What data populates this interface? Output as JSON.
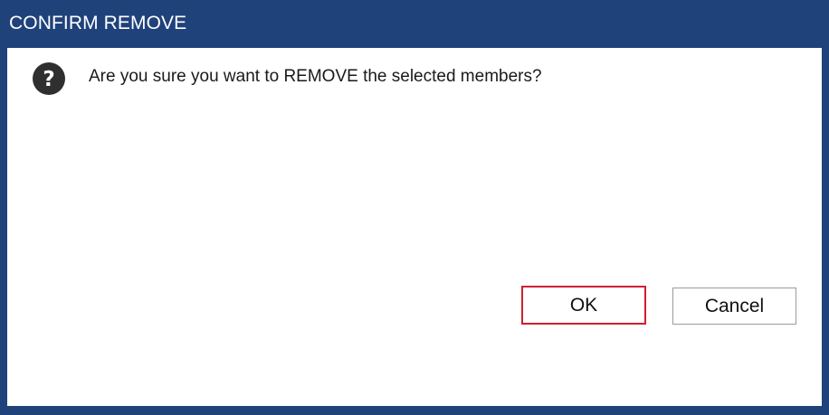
{
  "window": {
    "title": "CONFIRM REMOVE"
  },
  "message": {
    "text": "Are you sure you want to REMOVE the selected members?",
    "icon": "question-icon"
  },
  "buttons": {
    "ok_label": "OK",
    "cancel_label": "Cancel"
  },
  "colors": {
    "titlebar": "#1f427a",
    "focus_border": "#cf2030"
  }
}
